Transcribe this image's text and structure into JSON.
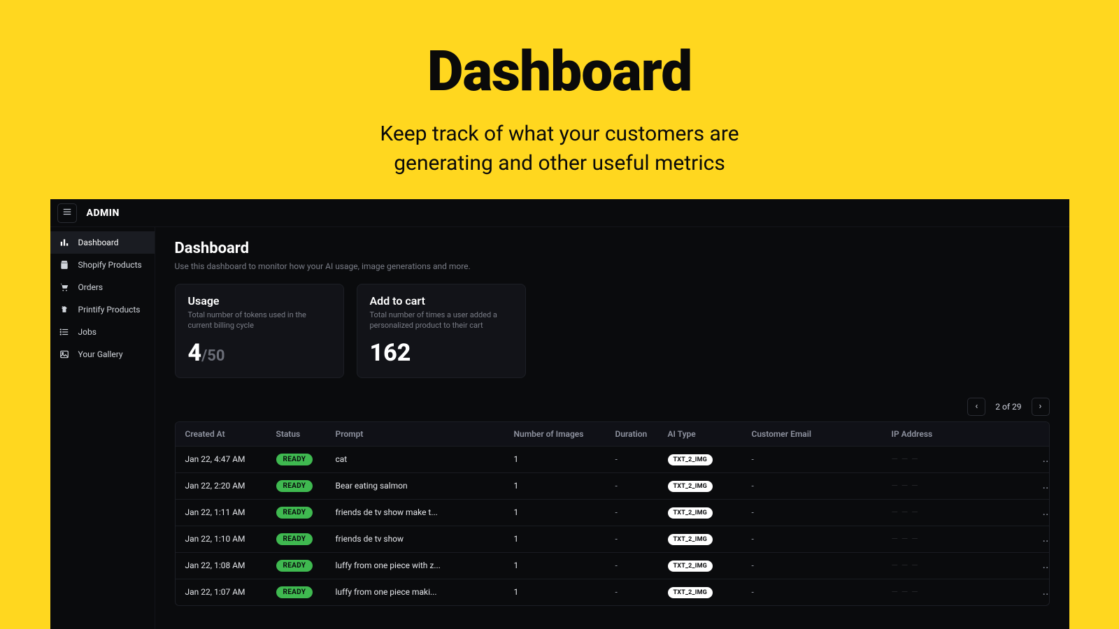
{
  "hero": {
    "title": "Dashboard",
    "subtitle_line1": "Keep track of what your customers are",
    "subtitle_line2": "generating and other useful metrics"
  },
  "topbar": {
    "brand": "ADMIN"
  },
  "sidebar": {
    "items": [
      {
        "label": "Dashboard",
        "active": true,
        "icon": "bar-chart-icon"
      },
      {
        "label": "Shopify Products",
        "active": false,
        "icon": "shopping-bag-icon"
      },
      {
        "label": "Orders",
        "active": false,
        "icon": "cart-icon"
      },
      {
        "label": "Printify Products",
        "active": false,
        "icon": "tshirt-icon"
      },
      {
        "label": "Jobs",
        "active": false,
        "icon": "list-icon"
      },
      {
        "label": "Your Gallery",
        "active": false,
        "icon": "image-icon"
      }
    ]
  },
  "page": {
    "title": "Dashboard",
    "subtitle": "Use this dashboard to monitor how your AI usage, image generations and more."
  },
  "cards": {
    "usage": {
      "title": "Usage",
      "desc": "Total number of tokens used in the current billing cycle",
      "value": "4",
      "of": "/",
      "limit": "50"
    },
    "add_to_cart": {
      "title": "Add to cart",
      "desc": "Total number of times a user added a personalized product to their cart",
      "value": "162"
    }
  },
  "pager": {
    "label": "2 of 29",
    "prev": "‹",
    "next": "›"
  },
  "table": {
    "columns": {
      "created_at": "Created At",
      "status": "Status",
      "prompt": "Prompt",
      "num_images": "Number of Images",
      "duration": "Duration",
      "ai_type": "AI Type",
      "customer_email": "Customer Email",
      "ip_address": "IP Address"
    },
    "rows": [
      {
        "created_at": "Jan 22, 4:47 AM",
        "status": "READY",
        "prompt": "cat",
        "num_images": "1",
        "duration": "-",
        "ai_type": "TXT_2_IMG",
        "customer_email": "-",
        "ip_action": "..."
      },
      {
        "created_at": "Jan 22, 2:20 AM",
        "status": "READY",
        "prompt": "Bear eating salmon",
        "num_images": "1",
        "duration": "-",
        "ai_type": "TXT_2_IMG",
        "customer_email": "-",
        "ip_action": "..."
      },
      {
        "created_at": "Jan 22, 1:11 AM",
        "status": "READY",
        "prompt": "friends de tv show make t...",
        "num_images": "1",
        "duration": "-",
        "ai_type": "TXT_2_IMG",
        "customer_email": "-",
        "ip_action": "..."
      },
      {
        "created_at": "Jan 22, 1:10 AM",
        "status": "READY",
        "prompt": "friends de tv show",
        "num_images": "1",
        "duration": "-",
        "ai_type": "TXT_2_IMG",
        "customer_email": "-",
        "ip_action": "..."
      },
      {
        "created_at": "Jan 22, 1:08 AM",
        "status": "READY",
        "prompt": "luffy from one piece with z...",
        "num_images": "1",
        "duration": "-",
        "ai_type": "TXT_2_IMG",
        "customer_email": "-",
        "ip_action": "..."
      },
      {
        "created_at": "Jan 22, 1:07 AM",
        "status": "READY",
        "prompt": "luffy from one piece maki...",
        "num_images": "1",
        "duration": "-",
        "ai_type": "TXT_2_IMG",
        "customer_email": "-",
        "ip_action": "..."
      }
    ]
  }
}
